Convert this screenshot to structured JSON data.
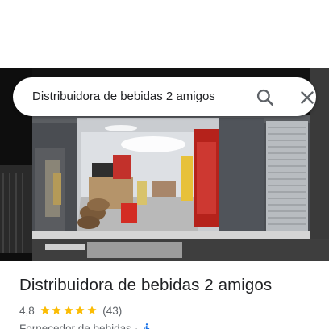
{
  "search": {
    "query": "Distribuidora de bebidas 2 amigos"
  },
  "place": {
    "name": "Distribuidora de bebidas 2 amigos",
    "rating": "4,8",
    "reviews": "(43)",
    "category": "Fornecedor de bebidas",
    "separator": "·"
  },
  "colors": {
    "star": "#fbbc04",
    "accessibility": "#1a73e8",
    "text_primary": "#202124",
    "text_secondary": "#5f6368"
  },
  "icons": {
    "search": "search-icon",
    "close": "close-icon",
    "star": "star-icon",
    "accessibility": "wheelchair-icon"
  }
}
